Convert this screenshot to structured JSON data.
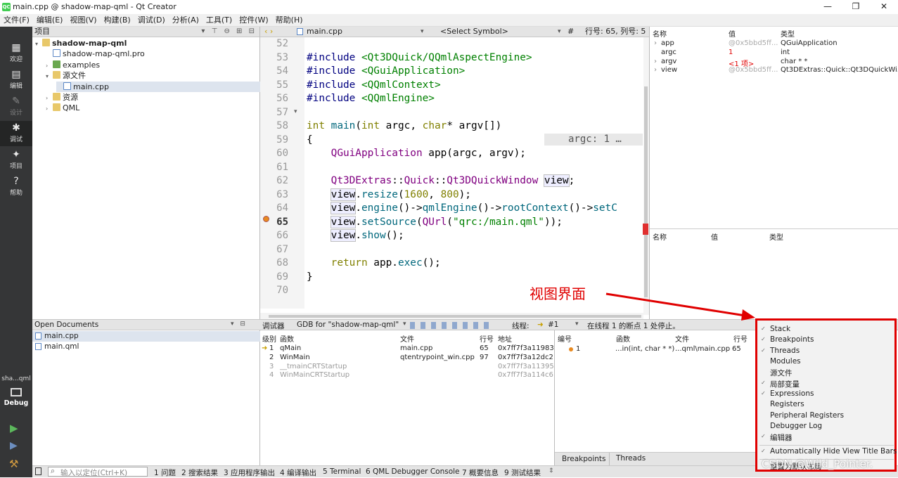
{
  "window": {
    "title": "main.cpp @ shadow-map-qml - Qt Creator",
    "app_icon": "QC",
    "min_glyph": "—",
    "max_glyph": "❐",
    "close_glyph": "✕"
  },
  "menu": [
    "文件(F)",
    "编辑(E)",
    "视图(V)",
    "构建(B)",
    "调试(D)",
    "分析(A)",
    "工具(T)",
    "控件(W)",
    "帮助(H)"
  ],
  "modes": [
    {
      "label": "欢迎",
      "icon": "grid-icon",
      "glyph": "▦"
    },
    {
      "label": "编辑",
      "icon": "edit-doc-icon",
      "glyph": "▤"
    },
    {
      "label": "设计",
      "icon": "pencil-icon",
      "glyph": "✎"
    },
    {
      "label": "调试",
      "icon": "bug-icon",
      "glyph": "✱"
    },
    {
      "label": "项目",
      "icon": "wrench-icon",
      "glyph": "✦"
    },
    {
      "label": "帮助",
      "icon": "help-icon",
      "glyph": "?"
    }
  ],
  "kit": {
    "name": "sha...qml",
    "mode": "Debug"
  },
  "run_glyphs": {
    "run": "▶",
    "debug": "▶",
    "build": "⚒"
  },
  "project": {
    "header": "项目",
    "tools": "▾ ⊤ ⊖ ⊞ ⊟",
    "tree": [
      {
        "label": "shadow-map-qml",
        "depth": 0,
        "arrow": "▾",
        "icon": "folder",
        "bold": true
      },
      {
        "label": "shadow-map-qml.pro",
        "depth": 1,
        "arrow": "",
        "icon": "file"
      },
      {
        "label": "examples",
        "depth": 1,
        "arrow": "›",
        "icon": "ex"
      },
      {
        "label": "源文件",
        "depth": 1,
        "arrow": "▾",
        "icon": "folder"
      },
      {
        "label": "main.cpp",
        "depth": 2,
        "arrow": "",
        "icon": "file",
        "selected": true
      },
      {
        "label": "资源",
        "depth": 1,
        "arrow": "›",
        "icon": "folder"
      },
      {
        "label": "QML",
        "depth": 1,
        "arrow": "›",
        "icon": "folder"
      }
    ]
  },
  "editor": {
    "nav": "‹ ›",
    "file": "main.cpp",
    "symbol": "<Select Symbol>",
    "hash": "#",
    "position": "行号: 65, 列号: 5",
    "breakpoint_line": "65",
    "lines": [
      "52",
      "53",
      "54",
      "55",
      "56",
      "57",
      "58",
      "59",
      "60",
      "61",
      "62",
      "63",
      "64",
      "65",
      "66",
      "67",
      "68",
      "69",
      "70"
    ],
    "fold_marker": "▾",
    "inline_tip": "argc: 1   …"
  },
  "locals": {
    "headers": [
      "名称",
      "值",
      "类型"
    ],
    "rows": [
      {
        "name": "app",
        "value": "@0x5bbd5ff...",
        "type": "QGuiApplication",
        "expand": "›"
      },
      {
        "name": "argc",
        "value": "1",
        "type": "int",
        "expand": "",
        "changed": true
      },
      {
        "name": "argv",
        "value": "<1 项>",
        "type": "char * *",
        "expand": "›",
        "changed": true
      },
      {
        "name": "view",
        "value": "@0x5bbd5ff...",
        "type": "Qt3DExtras::Quick::Qt3DQuickWi...",
        "expand": "›"
      }
    ],
    "expr_headers": [
      "名称",
      "值",
      "类型"
    ]
  },
  "debugbar": {
    "open_docs": "Open Documents",
    "debugger": "调试器",
    "engine": "GDB for \"shadow-map-qml\"",
    "thread_label": "线程:",
    "thread": "#1",
    "status": "在线程 1 的断点 1 处停止。"
  },
  "open_docs": [
    "main.cpp",
    "main.qml"
  ],
  "stack": {
    "headers": [
      "级别",
      "函数",
      "文件",
      "行号",
      "地址"
    ],
    "rows": [
      {
        "level": "1",
        "func": "qMain",
        "file": "main.cpp",
        "line": "65",
        "addr": "0x7ff7f3a11983",
        "current": true
      },
      {
        "level": "2",
        "func": "WinMain",
        "file": "qtentrypoint_win.cpp",
        "line": "97",
        "addr": "0x7ff7f3a12dc2"
      },
      {
        "level": "3",
        "func": "__tmainCRTStartup",
        "file": "",
        "line": "",
        "addr": "0x7ff7f3a11395",
        "dim": true
      },
      {
        "level": "4",
        "func": "WinMainCRTStartup",
        "file": "",
        "line": "",
        "addr": "0x7ff7f3a114c6",
        "dim": true
      }
    ]
  },
  "breakpoints": {
    "headers": [
      "编号",
      "函数",
      "文件",
      "行号"
    ],
    "rows": [
      {
        "num": "1",
        "func": "...in(int, char * *)",
        "file": "...qml\\main.cpp",
        "line": "65"
      }
    ],
    "tabs": [
      "Breakpoints",
      "Threads"
    ]
  },
  "statusbar": {
    "locator": "输入以定位(Ctrl+K)",
    "tabs": [
      "1 问题",
      "2 搜索结果",
      "3 应用程序输出",
      "4 编译输出",
      "5 Terminal",
      "6 QML Debugger Console",
      "7 概要信息",
      "9 测试结果"
    ]
  },
  "context_menu": {
    "items": [
      {
        "label": "Stack",
        "checked": true
      },
      {
        "label": "Breakpoints",
        "checked": true
      },
      {
        "label": "Threads",
        "checked": true
      },
      {
        "label": "Modules",
        "checked": false
      },
      {
        "label": "源文件",
        "checked": false
      },
      {
        "label": "局部变量",
        "checked": true
      },
      {
        "label": "Expressions",
        "checked": true
      },
      {
        "label": "Registers",
        "checked": false
      },
      {
        "label": "Peripheral Registers",
        "checked": false
      },
      {
        "label": "Debugger Log",
        "checked": false
      },
      {
        "label": "编辑器",
        "checked": true
      },
      {
        "label": "Automatically Hide View Title Bars",
        "checked": true
      },
      {
        "label": "重置为默认布局",
        "checked": false
      }
    ],
    "check_glyph": "✓"
  },
  "annotation": {
    "text": "视图界面",
    "color": "#e00000"
  },
  "watermark": "CSDN @Wild_Pointer."
}
